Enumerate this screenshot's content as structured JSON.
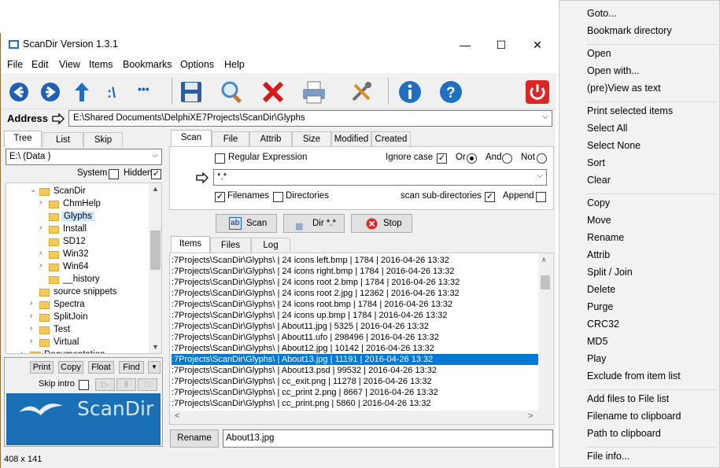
{
  "window": {
    "title": "ScanDir Version 1.3.1",
    "minimize": "—",
    "maximize": "☐",
    "close": "✕"
  },
  "menu": [
    "File",
    "Edit",
    "View",
    "Items",
    "Bookmarks",
    "Options",
    "Help"
  ],
  "toolbar": {
    "icons": [
      "back-icon",
      "forward-icon",
      "up-icon",
      "root-icon",
      "more-icon",
      "save-icon",
      "search-icon",
      "delete-icon",
      "print-icon",
      "tools-icon",
      "info-icon",
      "help-icon",
      "power-icon"
    ],
    "more_label": "•••"
  },
  "address": {
    "label": "Address",
    "value": "E:\\Shared Documents\\DelphiXE7Projects\\ScanDir\\Glyphs"
  },
  "left_tabs": [
    "Tree",
    "List",
    "Skip"
  ],
  "drive": "E:\\ (Data )",
  "system_label": "System",
  "hidden_label": "Hidden",
  "tree": [
    {
      "label": "ScanDir",
      "arrow": "⌄"
    },
    {
      "label": "ChmHelp",
      "arrow": "›"
    },
    {
      "label": "Glyphs",
      "arrow": ""
    },
    {
      "label": "Install",
      "arrow": "›"
    },
    {
      "label": "SD12",
      "arrow": ""
    },
    {
      "label": "Win32",
      "arrow": "›"
    },
    {
      "label": "Win64",
      "arrow": "›"
    },
    {
      "label": "__history",
      "arrow": ""
    },
    {
      "label": "source snippets",
      "arrow": ""
    },
    {
      "label": "Spectra",
      "arrow": "›"
    },
    {
      "label": "SplitJoin",
      "arrow": "›"
    },
    {
      "label": "Test",
      "arrow": "›"
    },
    {
      "label": "Virtual",
      "arrow": "›"
    },
    {
      "label": "Documentation",
      "arrow": "›"
    }
  ],
  "left_buttons": {
    "print": "Print",
    "copy": "Copy",
    "float": "Float",
    "find": "Find"
  },
  "skip_intro": "Skip intro",
  "logo_text": "ScanDir",
  "status": "408 x 141",
  "scan_tabs": [
    "Scan",
    "File",
    "Attrib",
    "Size",
    "Modified",
    "Created"
  ],
  "scan": {
    "regex": "Regular Expression",
    "ignore_case": "Ignore case",
    "or": "Or",
    "and": "And",
    "not": "Not",
    "pattern": "*.*",
    "filenames": "Filenames",
    "directories": "Directories",
    "subdirs": "scan sub-directories",
    "append": "Append"
  },
  "buttons": {
    "scan": "Scan",
    "dir": "Dir *.*",
    "stop": "Stop"
  },
  "result_tabs": [
    "Items",
    "Files",
    "Log"
  ],
  "items": [
    ":7Projects\\ScanDir\\Glyphs\\ | 24 icons left.bmp | 1784 | 2016-04-26 13:32",
    ":7Projects\\ScanDir\\Glyphs\\ | 24 icons right.bmp | 1784 | 2016-04-26 13:32",
    ":7Projects\\ScanDir\\Glyphs\\ | 24 icons root 2.bmp | 1784 | 2016-04-26 13:32",
    ":7Projects\\ScanDir\\Glyphs\\ | 24 icons root 2.jpg | 12362 | 2016-04-26 13:32",
    ":7Projects\\ScanDir\\Glyphs\\ | 24 icons root.bmp | 1784 | 2016-04-26 13:32",
    ":7Projects\\ScanDir\\Glyphs\\ | 24 icons up.bmp | 1784 | 2016-04-26 13:32",
    ":7Projects\\ScanDir\\Glyphs\\ | About11.jpg | 5325 | 2016-04-26 13:32",
    ":7Projects\\ScanDir\\Glyphs\\ | About11.ufo | 298496 | 2016-04-26 13:32",
    ":7Projects\\ScanDir\\Glyphs\\ | About12.jpg | 10142 | 2016-04-26 13:32",
    ":7Projects\\ScanDir\\Glyphs\\ | About13.jpg | 11191 | 2016-04-26 13:32",
    ":7Projects\\ScanDir\\Glyphs\\ | About13.psd | 99532 | 2016-04-26 13:32",
    ":7Projects\\ScanDir\\Glyphs\\ | cc_exit.png | 11278 | 2016-04-26 13:32",
    ":7Projects\\ScanDir\\Glyphs\\ | cc_print 2.png | 8667 | 2016-04-26 13:32",
    ":7Projects\\ScanDir\\Glyphs\\ | cc_print.png | 5860 | 2016-04-26 13:32"
  ],
  "selected_item": 9,
  "rename": {
    "button": "Rename",
    "value": "About13.jpg"
  },
  "context_menu": [
    {
      "label": "Goto...",
      "group": 0
    },
    {
      "label": "Bookmark directory",
      "group": 0
    },
    {
      "label": "Open",
      "group": 1
    },
    {
      "label": "Open with...",
      "group": 1
    },
    {
      "label": "(pre)View as text",
      "group": 1
    },
    {
      "label": "Print selected items",
      "group": 2
    },
    {
      "label": "Select All",
      "group": 2
    },
    {
      "label": "Select None",
      "group": 2
    },
    {
      "label": "Sort",
      "group": 2
    },
    {
      "label": "Clear",
      "group": 2
    },
    {
      "label": "Copy",
      "group": 3
    },
    {
      "label": "Move",
      "group": 3
    },
    {
      "label": "Rename",
      "group": 3
    },
    {
      "label": "Attrib",
      "group": 3
    },
    {
      "label": "Split / Join",
      "group": 3
    },
    {
      "label": "Delete",
      "group": 3
    },
    {
      "label": "Purge",
      "group": 3
    },
    {
      "label": "CRC32",
      "group": 3
    },
    {
      "label": "MD5",
      "group": 3
    },
    {
      "label": "Play",
      "group": 3
    },
    {
      "label": "Exclude from item list",
      "group": 3
    },
    {
      "label": "Add files to File list",
      "group": 4
    },
    {
      "label": "Filename to clipboard",
      "group": 4
    },
    {
      "label": "Path to clipboard",
      "group": 4
    },
    {
      "label": "File info...",
      "group": 5
    }
  ],
  "colors": {
    "selection": "#0078d7",
    "title_border": "#8a6d3b",
    "logo_bg": "#1a6fb5"
  }
}
